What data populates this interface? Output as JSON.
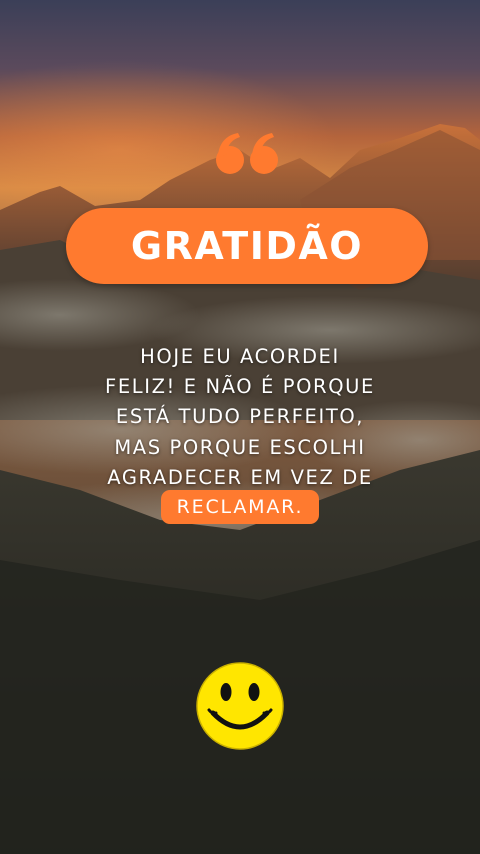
{
  "title": "GRATIDÃO",
  "message_lines": [
    "HOJE EU ACORDEI",
    "FELIZ! E NÃO É PORQUE",
    "ESTÁ TUDO PERFEITO,",
    "MAS PORQUE ESCOLHI",
    "AGRADECER EM VEZ DE"
  ],
  "highlight_word": "RECLAMAR.",
  "icons": [
    "quote-mark-icon",
    "smiley-face-icon"
  ],
  "colors": {
    "accent": "#ff7a2f",
    "text": "#ffffff",
    "smiley_face": "#ffe600"
  }
}
